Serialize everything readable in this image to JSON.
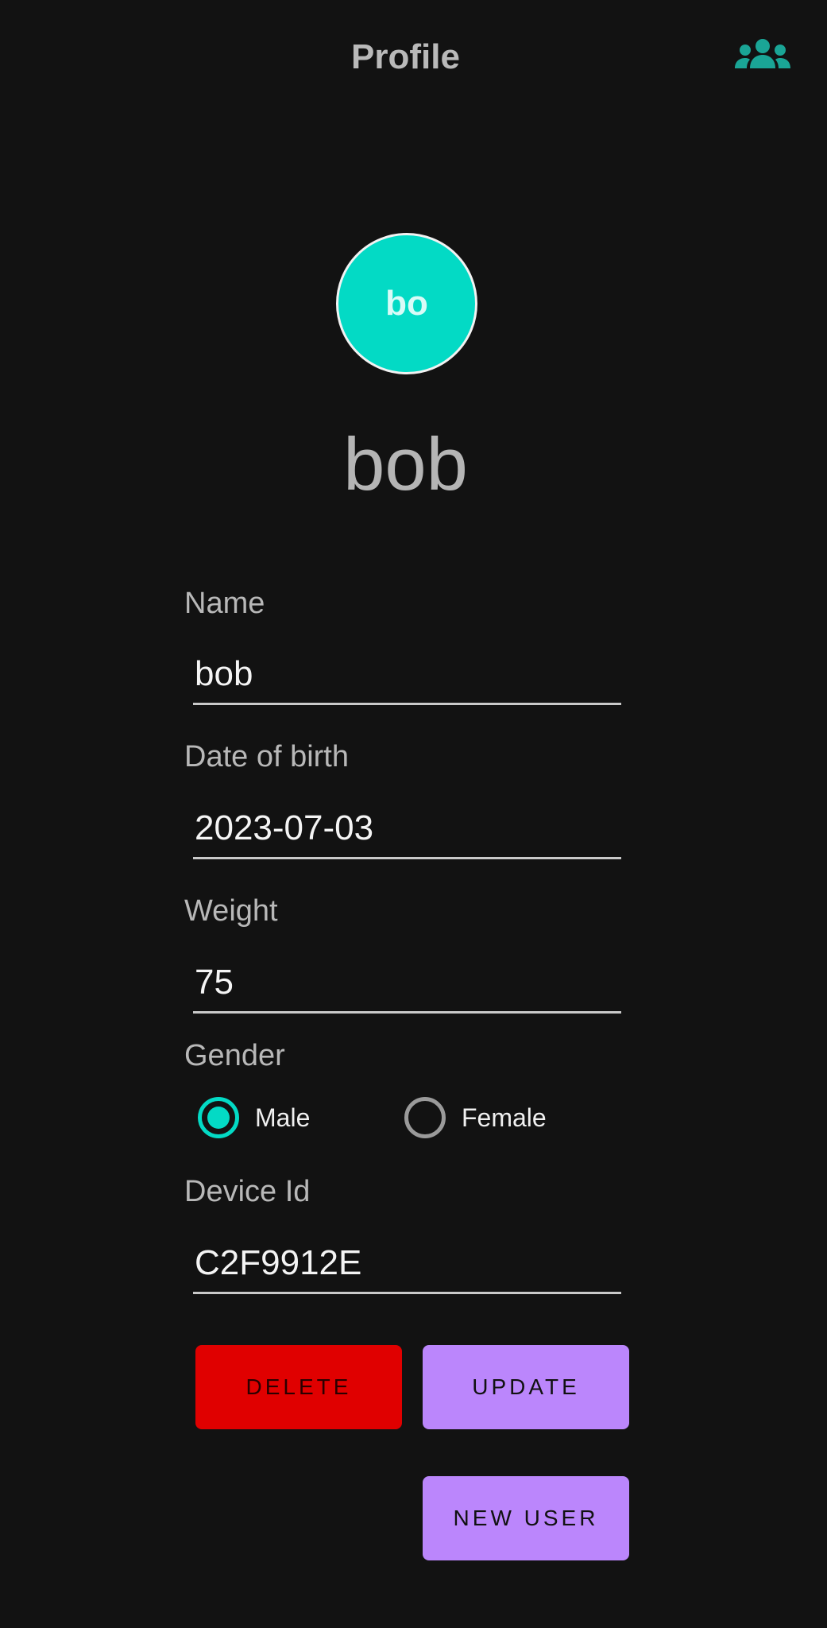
{
  "header": {
    "title": "Profile",
    "users_icon": "people-group-icon",
    "accent_color": "#1aa596"
  },
  "profile": {
    "avatar_initials": "bo",
    "avatar_color": "#03dac5",
    "display_name": "bob"
  },
  "form": {
    "name": {
      "label": "Name",
      "value": "bob"
    },
    "dob": {
      "label": "Date of birth",
      "value": "2023-07-03"
    },
    "weight": {
      "label": "Weight",
      "value": "75"
    },
    "gender": {
      "label": "Gender",
      "options": [
        {
          "label": "Male",
          "checked": true
        },
        {
          "label": "Female",
          "checked": false
        }
      ]
    },
    "device": {
      "label": "Device Id",
      "value": "C2F9912E"
    }
  },
  "actions": {
    "delete_label": "DELETE",
    "update_label": "UPDATE",
    "new_user_label": "NEW USER",
    "delete_color": "#e00000",
    "primary_color": "#bb86fc"
  }
}
